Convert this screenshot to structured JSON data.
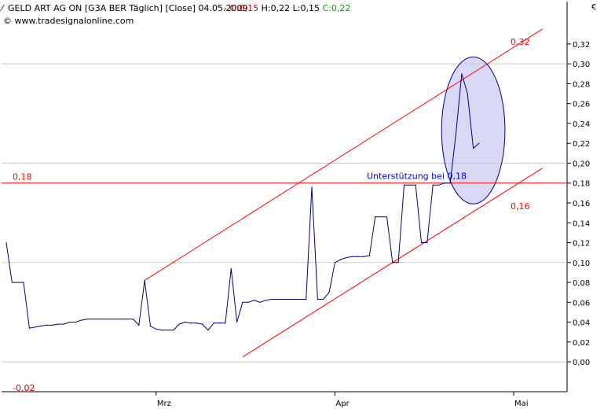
{
  "header": {
    "icon": "line-chart-icon",
    "instrument": "GELD ART AG ON [G3A BER  Täglich] [Close] 04.05.2009",
    "ohlc": [
      {
        "label": "O:",
        "value": "0,15",
        "color": "#cc0000"
      },
      {
        "label": "H:",
        "value": "0,22",
        "color": "#000000"
      },
      {
        "label": "L:",
        "value": "0,15",
        "color": "#000000"
      },
      {
        "label": "C:",
        "value": "0,22",
        "color": "#00a000"
      }
    ],
    "copyright": "© www.tradesignalonline.com"
  },
  "chart_data": {
    "type": "line",
    "currency": "€",
    "y_axis_side": "right",
    "ylim": [
      -0.03,
      0.35
    ],
    "y_ticks": [
      "0,00",
      "0,02",
      "0,04",
      "0,06",
      "0,08",
      "0,10",
      "0,12",
      "0,14",
      "0,16",
      "0,18",
      "0,20",
      "0,22",
      "0,24",
      "0,26",
      "0,28",
      "0,30",
      "0,32"
    ],
    "y_tick_values": [
      0.0,
      0.02,
      0.04,
      0.06,
      0.08,
      0.1,
      0.12,
      0.14,
      0.16,
      0.18,
      0.2,
      0.22,
      0.24,
      0.26,
      0.28,
      0.3,
      0.32
    ],
    "gridlines_at": [
      0.0,
      0.1,
      0.2,
      0.3
    ],
    "x_labels": [
      {
        "label": "Mrz",
        "x": 26
      },
      {
        "label": "Apr",
        "x": 57
      },
      {
        "label": "Mai",
        "x": 88
      }
    ],
    "xlim": [
      0,
      97
    ],
    "series": [
      {
        "color": "#000080",
        "points": [
          [
            0,
            0.12
          ],
          [
            1,
            0.08
          ],
          [
            2,
            0.08
          ],
          [
            3,
            0.08
          ],
          [
            4,
            0.034
          ],
          [
            5,
            0.035
          ],
          [
            6,
            0.036
          ],
          [
            7,
            0.037
          ],
          [
            8,
            0.037
          ],
          [
            9,
            0.038
          ],
          [
            10,
            0.038
          ],
          [
            11,
            0.04
          ],
          [
            12,
            0.04
          ],
          [
            13,
            0.042
          ],
          [
            14,
            0.043
          ],
          [
            15,
            0.043
          ],
          [
            16,
            0.043
          ],
          [
            17,
            0.043
          ],
          [
            18,
            0.043
          ],
          [
            19,
            0.043
          ],
          [
            20,
            0.043
          ],
          [
            21,
            0.043
          ],
          [
            22,
            0.043
          ],
          [
            23,
            0.037
          ],
          [
            24,
            0.082
          ],
          [
            25,
            0.036
          ],
          [
            26,
            0.033
          ],
          [
            27,
            0.032
          ],
          [
            28,
            0.032
          ],
          [
            29,
            0.032
          ],
          [
            30,
            0.038
          ],
          [
            31,
            0.04
          ],
          [
            32,
            0.039
          ],
          [
            33,
            0.039
          ],
          [
            34,
            0.038
          ],
          [
            35,
            0.032
          ],
          [
            36,
            0.039
          ],
          [
            37,
            0.039
          ],
          [
            38,
            0.039
          ],
          [
            39,
            0.094
          ],
          [
            40,
            0.04
          ],
          [
            41,
            0.06
          ],
          [
            42,
            0.06
          ],
          [
            43,
            0.062
          ],
          [
            44,
            0.06
          ],
          [
            45,
            0.062
          ],
          [
            46,
            0.063
          ],
          [
            47,
            0.063
          ],
          [
            48,
            0.063
          ],
          [
            49,
            0.063
          ],
          [
            50,
            0.063
          ],
          [
            51,
            0.063
          ],
          [
            52,
            0.063
          ],
          [
            53,
            0.176
          ],
          [
            54,
            0.063
          ],
          [
            55,
            0.063
          ],
          [
            56,
            0.07
          ],
          [
            57,
            0.1
          ],
          [
            58,
            0.103
          ],
          [
            59,
            0.105
          ],
          [
            60,
            0.106
          ],
          [
            61,
            0.106
          ],
          [
            62,
            0.106
          ],
          [
            63,
            0.107
          ],
          [
            64,
            0.146
          ],
          [
            65,
            0.146
          ],
          [
            66,
            0.146
          ],
          [
            67,
            0.1
          ],
          [
            68,
            0.1
          ],
          [
            69,
            0.178
          ],
          [
            70,
            0.178
          ],
          [
            71,
            0.178
          ],
          [
            72,
            0.12
          ],
          [
            73,
            0.12
          ],
          [
            74,
            0.178
          ],
          [
            75,
            0.178
          ],
          [
            76,
            0.18
          ],
          [
            77,
            0.18
          ],
          [
            78,
            0.23
          ],
          [
            79,
            0.29
          ],
          [
            80,
            0.27
          ],
          [
            81,
            0.215
          ],
          [
            82,
            0.22
          ]
        ]
      }
    ],
    "horizontal_line": {
      "y": 0.18,
      "label": "0,18",
      "color": "#ff0000"
    },
    "channel_lines": [
      {
        "label": "0,32",
        "from": [
          24,
          0.082
        ],
        "to": [
          93,
          0.335
        ],
        "color": "#ff0000"
      },
      {
        "label": "0,16",
        "from": [
          41,
          0.005
        ],
        "to": [
          93,
          0.195
        ],
        "color": "#ff0000"
      }
    ],
    "annotations": [
      {
        "text": "Unterstützung bei 0,18",
        "at": [
          60,
          0.18
        ],
        "color": "#0000cc"
      },
      {
        "text": "-0,02",
        "at": [
          2,
          -0.02
        ],
        "color": "#cc0000"
      }
    ],
    "highlight_ellipse": {
      "center": [
        81,
        0.233
      ],
      "rx_units": 5.5,
      "ry_units": 0.074,
      "fill": "#c0c0f0",
      "stroke": "#000080"
    }
  }
}
